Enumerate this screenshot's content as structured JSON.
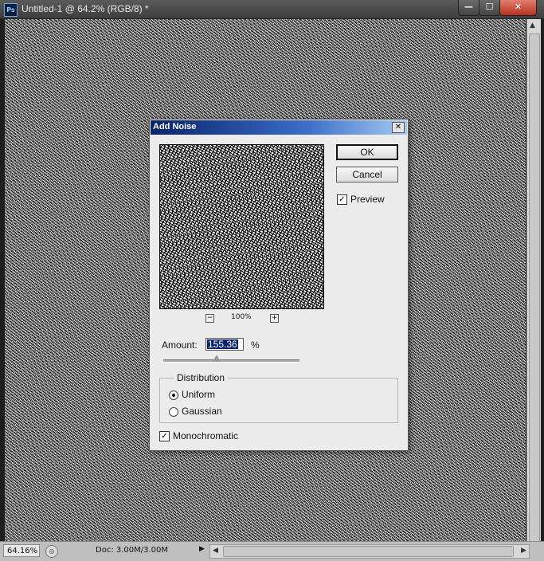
{
  "window": {
    "app_icon": "Ps",
    "title": "Untitled-1 @ 64.2% (RGB/8) *",
    "controls": {
      "minimize": "—",
      "maximize": "☐",
      "close": "✕"
    }
  },
  "status_bar": {
    "zoom": "64.16%",
    "doc_info": "Doc: 3.00M/3.00M",
    "arrow": "▶"
  },
  "scrollbars": {
    "up": "▲",
    "down": "▼",
    "left": "◀",
    "right": "▶"
  },
  "dialog": {
    "title": "Add Noise",
    "close": "✕",
    "ok_label": "OK",
    "cancel_label": "Cancel",
    "preview": {
      "label": "Preview",
      "checked": true,
      "check_glyph": "✓"
    },
    "zoom": {
      "out": "−",
      "value": "100%",
      "in": "+"
    },
    "amount": {
      "label": "Amount:",
      "value": "155.36",
      "unit": "%",
      "slider_fraction": 0.39
    },
    "distribution": {
      "legend": "Distribution",
      "options": [
        {
          "label": "Uniform",
          "selected": true
        },
        {
          "label": "Gaussian",
          "selected": false
        }
      ]
    },
    "monochromatic": {
      "label": "Monochromatic",
      "checked": true,
      "check_glyph": "✓"
    }
  },
  "colors": {
    "title_gradient_start": "#0a2468",
    "title_gradient_end": "#a6caf0",
    "selection": "#0a246a"
  }
}
